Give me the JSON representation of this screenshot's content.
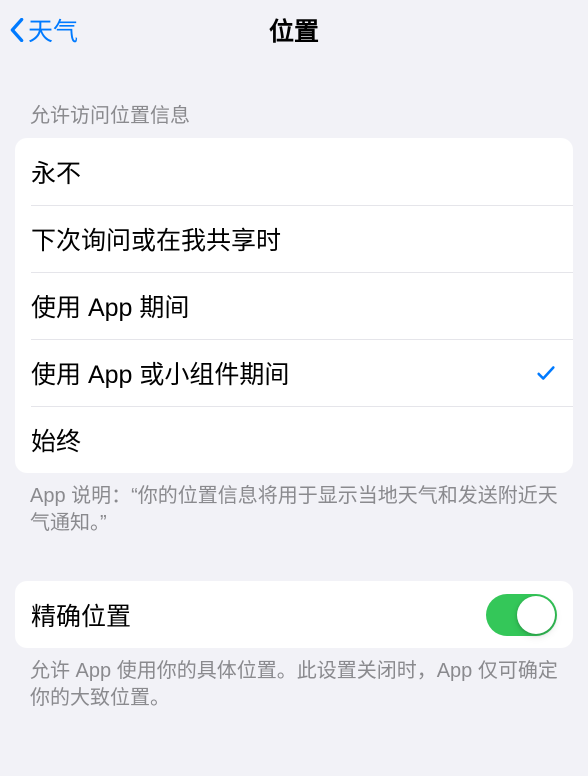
{
  "header": {
    "back_label": "天气",
    "title": "位置"
  },
  "section1": {
    "header": "允许访问位置信息",
    "options": [
      {
        "label": "永不",
        "selected": false
      },
      {
        "label": "下次询问或在我共享时",
        "selected": false
      },
      {
        "label": "使用 App 期间",
        "selected": false
      },
      {
        "label": "使用 App 或小组件期间",
        "selected": true
      },
      {
        "label": "始终",
        "selected": false
      }
    ],
    "footer": "App 说明：“你的位置信息将用于显示当地天气和发送附近天气通知。”"
  },
  "section2": {
    "precise_label": "精确位置",
    "precise_on": true,
    "footer": "允许 App 使用你的具体位置。此设置关闭时，App 仅可确定你的大致位置。"
  }
}
